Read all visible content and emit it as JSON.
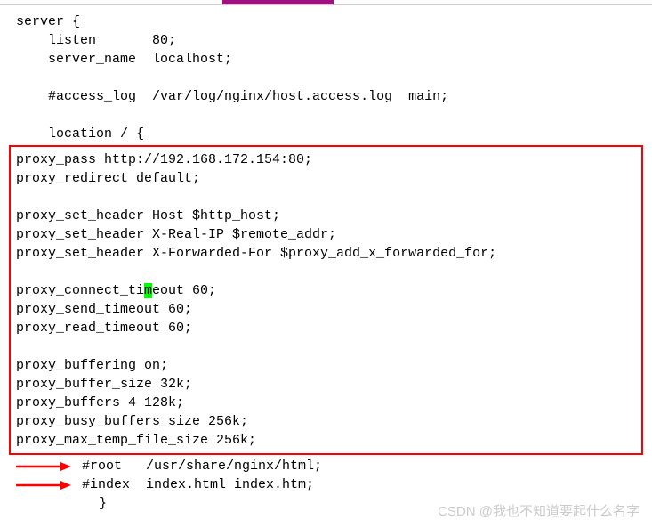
{
  "config": {
    "top_lines": [
      "server {",
      "    listen       80;",
      "    server_name  localhost;",
      "",
      "    #access_log  /var/log/nginx/host.access.log  main;",
      "",
      "    location / {"
    ],
    "boxed_lines_before_highlight": [
      "proxy_pass http://192.168.172.154:80;",
      "proxy_redirect default;",
      "",
      "proxy_set_header Host $http_host;",
      "proxy_set_header X-Real-IP $remote_addr;",
      "proxy_set_header X-Forwarded-For $proxy_add_x_forwarded_for;",
      ""
    ],
    "highlight_line": {
      "before": "proxy_connect_ti",
      "highlighted": "m",
      "after": "eout 60;"
    },
    "boxed_lines_after_highlight": [
      "proxy_send_timeout 60;",
      "proxy_read_timeout 60;",
      "",
      "proxy_buffering on;",
      "proxy_buffer_size 32k;",
      "proxy_buffers 4 128k;",
      "proxy_busy_buffers_size 256k;",
      "proxy_max_temp_file_size 256k;"
    ],
    "arrow_lines": [
      "#root   /usr/share/nginx/html;",
      "#index  index.html index.htm;"
    ],
    "closing_brace": "    }"
  },
  "watermark": "CSDN @我也不知道要起什么名字"
}
